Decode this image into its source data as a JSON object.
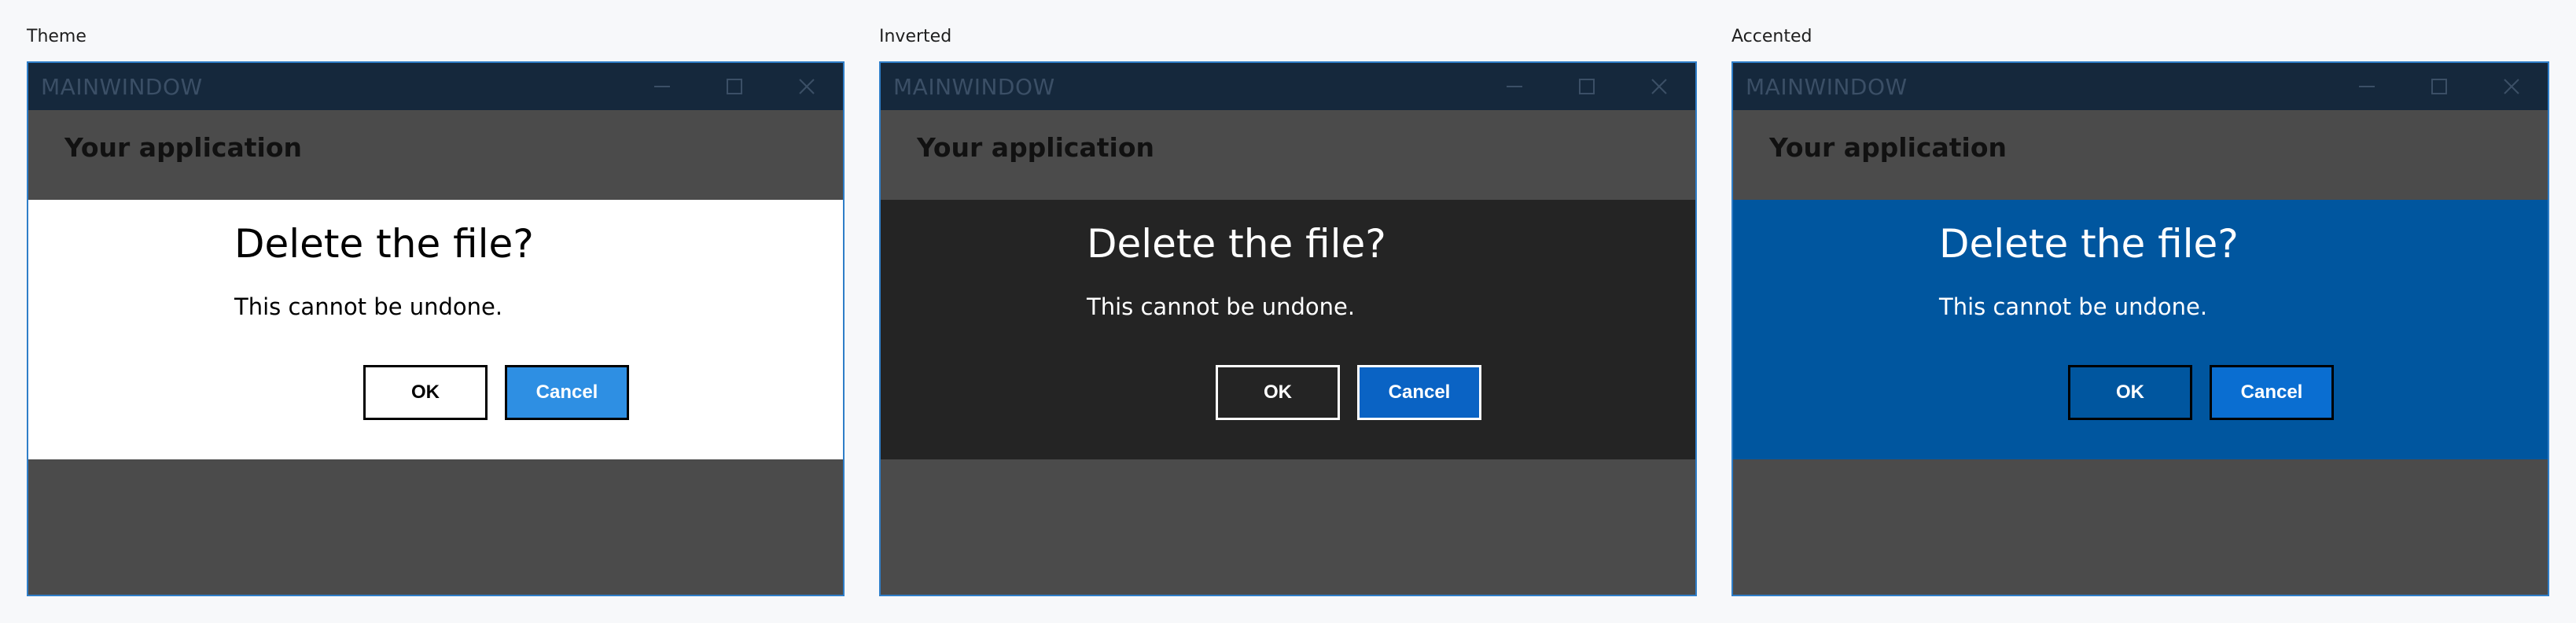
{
  "panels": [
    {
      "label": "Theme",
      "window": {
        "title": "MAINWINDOW",
        "app_title": "Your application",
        "dialog": {
          "title": "Delete the file?",
          "message": "This cannot be undone.",
          "ok_label": "OK",
          "cancel_label": "Cancel"
        }
      }
    },
    {
      "label": "Inverted",
      "window": {
        "title": "MAINWINDOW",
        "app_title": "Your application",
        "dialog": {
          "title": "Delete the file?",
          "message": "This cannot be undone.",
          "ok_label": "OK",
          "cancel_label": "Cancel"
        }
      }
    },
    {
      "label": "Accented",
      "window": {
        "title": "MAINWINDOW",
        "app_title": "Your application",
        "dialog": {
          "title": "Delete the file?",
          "message": "This cannot be undone.",
          "ok_label": "OK",
          "cancel_label": "Cancel"
        }
      }
    }
  ],
  "icons": {
    "minimize": "minimize-icon",
    "maximize": "maximize-icon",
    "close": "close-icon"
  },
  "colors": {
    "window_border": "#2f7ec8",
    "titlebar": "#15283c",
    "app_background": "#4b4b4b",
    "theme_dialog": "#ffffff",
    "theme_cancel": "#2e8fe3",
    "inverted_dialog": "#242424",
    "inverted_cancel": "#0a63c4",
    "accented_dialog": "#00569f",
    "accented_cancel": "#0a6ed1"
  }
}
